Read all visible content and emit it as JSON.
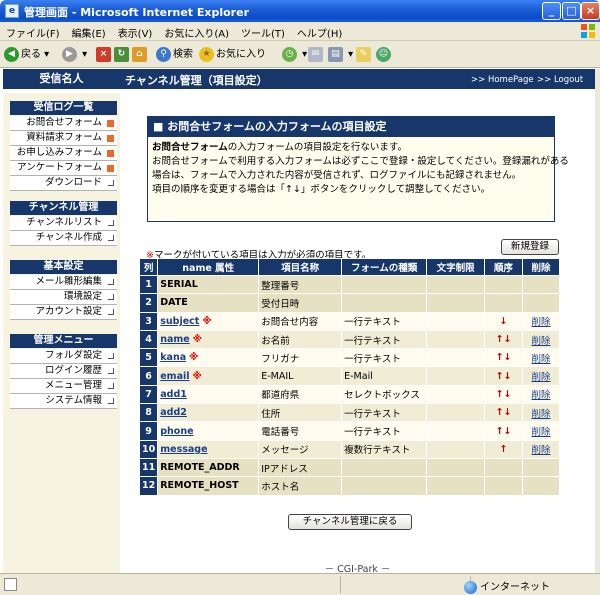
{
  "window": {
    "title": "管理画面 - Microsoft Internet Explorer",
    "buttons": {
      "minimize": "_",
      "maximize": "□",
      "close": "×"
    }
  },
  "menubar": {
    "items": [
      "ファイル(F)",
      "編集(E)",
      "表示(V)",
      "お気に入り(A)",
      "ツール(T)",
      "ヘルプ(H)"
    ]
  },
  "toolbar": {
    "back_label": "戻る",
    "search_label": "検索",
    "favorites_label": "お気に入り"
  },
  "sidebar": {
    "header": "受信名人",
    "sections": [
      {
        "title": "受信ログ一覧",
        "items": [
          {
            "label": "お問合せフォーム",
            "marker": "red"
          },
          {
            "label": "資料請求フォーム",
            "marker": "red"
          },
          {
            "label": "お申し込みフォーム",
            "marker": "red"
          },
          {
            "label": "アンケートフォーム",
            "marker": "red"
          },
          {
            "label": "ダウンロード",
            "marker": "box"
          }
        ]
      },
      {
        "title": "チャンネル管理",
        "items": [
          {
            "label": "チャンネルリスト",
            "marker": "box"
          },
          {
            "label": "チャンネル作成",
            "marker": "box"
          }
        ]
      },
      {
        "title": "基本設定",
        "items": [
          {
            "label": "メール雛形編集",
            "marker": "box"
          },
          {
            "label": "環境設定",
            "marker": "box"
          },
          {
            "label": "アカウント設定",
            "marker": "box"
          }
        ]
      },
      {
        "title": "管理メニュー",
        "items": [
          {
            "label": "フォルダ設定",
            "marker": "box"
          },
          {
            "label": "ログイン履歴",
            "marker": "box"
          },
          {
            "label": "メニュー管理",
            "marker": "box"
          },
          {
            "label": "システム情報",
            "marker": "box"
          }
        ]
      }
    ]
  },
  "main": {
    "title": "チャンネル管理（項目設定）",
    "links": {
      "homepage": ">> HomePage",
      "logout": ">> Logout"
    },
    "info": {
      "title": "■ お問合せフォームの入力フォームの項目設定",
      "form_name": "お問合せフォーム",
      "line1_rest": "の入力フォームの項目設定を行ないます。",
      "line2": "お問合せフォームで利用する入力フォームは必ずここで登録・設定してください。登録漏れがある",
      "line3": "場合は、フォームで入力された内容が受信されず、ログファイルにも記録されません。",
      "line4": "項目の順序を変更する場合は「↑↓」ボタンをクリックして調整してください。"
    },
    "note_mark": "※",
    "note_text": "マークが付いている項目は入力が必須の項目です。",
    "new_button": "新規登録",
    "table": {
      "headers": [
        "列",
        "name 属性",
        "項目名称",
        "フォームの種類",
        "文字制限",
        "順序",
        "削除"
      ],
      "rows": [
        {
          "num": "1",
          "name": "SERIAL",
          "link": false,
          "req": false,
          "label": "整理番号",
          "type": "",
          "limit": "",
          "order": "",
          "del": "",
          "style": "fixed"
        },
        {
          "num": "2",
          "name": "DATE",
          "link": false,
          "req": false,
          "label": "受付日時",
          "type": "",
          "limit": "",
          "order": "",
          "del": "",
          "style": "fixed"
        },
        {
          "num": "3",
          "name": "subject",
          "link": true,
          "req": true,
          "label": "お問合せ内容",
          "type": "一行テキスト",
          "limit": "",
          "order": "↓",
          "del": "削除",
          "style": "even"
        },
        {
          "num": "4",
          "name": "name",
          "link": true,
          "req": true,
          "label": "お名前",
          "type": "一行テキスト",
          "limit": "",
          "order": "↑↓",
          "del": "削除",
          "style": "odd"
        },
        {
          "num": "5",
          "name": "kana",
          "link": true,
          "req": true,
          "label": "フリガナ",
          "type": "一行テキスト",
          "limit": "",
          "order": "↑↓",
          "del": "削除",
          "style": "even"
        },
        {
          "num": "6",
          "name": "email",
          "link": true,
          "req": true,
          "label": "E-MAIL",
          "type": "E-Mail",
          "limit": "",
          "order": "↑↓",
          "del": "削除",
          "style": "odd"
        },
        {
          "num": "7",
          "name": "add1",
          "link": true,
          "req": false,
          "label": "都道府県",
          "type": "セレクトボックス",
          "limit": "",
          "order": "↑↓",
          "del": "削除",
          "style": "even"
        },
        {
          "num": "8",
          "name": "add2",
          "link": true,
          "req": false,
          "label": "住所",
          "type": "一行テキスト",
          "limit": "",
          "order": "↑↓",
          "del": "削除",
          "style": "odd"
        },
        {
          "num": "9",
          "name": "phone",
          "link": true,
          "req": false,
          "label": "電話番号",
          "type": "一行テキスト",
          "limit": "",
          "order": "↑↓",
          "del": "削除",
          "style": "even"
        },
        {
          "num": "10",
          "name": "message",
          "link": true,
          "req": false,
          "label": "メッセージ",
          "type": "複数行テキスト",
          "limit": "",
          "order": "↑",
          "del": "削除",
          "style": "odd"
        },
        {
          "num": "11",
          "name": "REMOTE_ADDR",
          "link": false,
          "req": false,
          "label": "IPアドレス",
          "type": "",
          "limit": "",
          "order": "",
          "del": "",
          "style": "fixed"
        },
        {
          "num": "12",
          "name": "REMOTE_HOST",
          "link": false,
          "req": false,
          "label": "ホスト名",
          "type": "",
          "limit": "",
          "order": "",
          "del": "",
          "style": "fixed"
        }
      ]
    },
    "back_button": "チャンネル管理に戻る",
    "footer": "－ CGI-Park －"
  },
  "statusbar": {
    "zone": "インターネット"
  }
}
